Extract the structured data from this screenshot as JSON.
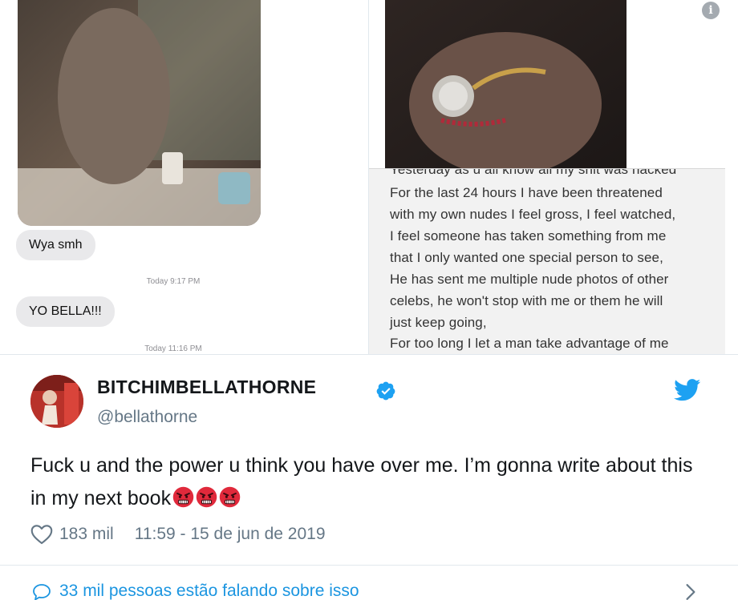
{
  "messages": {
    "bubble_1": "Wya smh",
    "timestamp_1": "Today 9:17 PM",
    "bubble_2": "YO BELLA!!!",
    "timestamp_2": "Today 11:16 PM"
  },
  "notes": {
    "lines": [
      "Yesterday as u all know all my shit was hacked",
      "For the last 24 hours I have been threatened",
      "with my own nudes I feel gross, I feel watched,",
      "I feel someone has taken something from me",
      "that I only wanted one special person to see,",
      "He has sent me multiple nude photos of other",
      "celebs, he won't stop with me or them he will",
      "just keep going,",
      "For too long I let a man take advantage of me"
    ]
  },
  "tweet": {
    "display_name": "BITCHIMBELLATHORNE",
    "handle": "@bellathorne",
    "text": "Fuck u and the power u think you have over me. I’m gonna write about this in my next book",
    "likes": "183 mil",
    "datetime": "11:59 - 15 de jun de 2019",
    "footer_text": "33 mil pessoas estão falando sobre isso",
    "emojis": [
      "angry-face",
      "angry-face",
      "angry-face"
    ]
  },
  "icons": {
    "info": "info-icon",
    "verified": "verified-badge-icon",
    "twitter": "twitter-bird-icon",
    "heart": "heart-icon",
    "reply": "speech-bubble-icon",
    "chevron": "chevron-right-icon"
  },
  "colors": {
    "twitter_blue": "#1da1f2",
    "link_blue": "#1b95e0",
    "muted_text": "#657786",
    "bubble_gray": "#e9e9eb",
    "notes_bg": "#f2f2f2",
    "emoji_red": "#e0293b"
  }
}
